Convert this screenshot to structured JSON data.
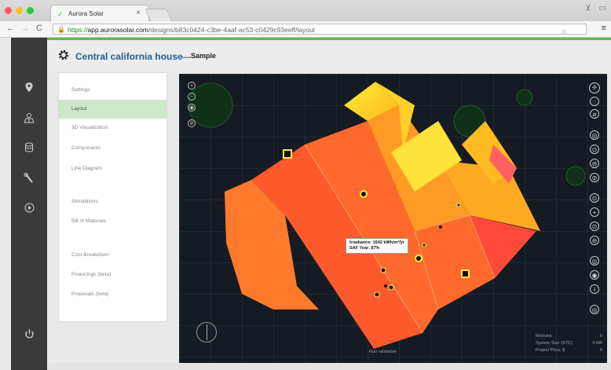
{
  "browser": {
    "tab_title": "Aurora Solar",
    "tab_close": "×",
    "url_scheme": "https://",
    "url_host": "app.aurorasolar.com",
    "url_path": "/designs/b83c0424-c3be-4aaf-ac53-c0429c93eeff/layout"
  },
  "header": {
    "title": "Central california house",
    "dash": "—",
    "subtitle": "Sample"
  },
  "nav": {
    "items": [
      {
        "label": "Settings",
        "active": false
      },
      {
        "label": "Layout",
        "active": true
      },
      {
        "label": "3D Visualization",
        "active": false
      },
      {
        "label": "Components",
        "active": false
      },
      {
        "label": "Line Diagram",
        "active": false
      },
      {
        "label": "Simulations",
        "active": false
      },
      {
        "label": "Bill of Materials",
        "active": false
      },
      {
        "label": "Cost Breakdown",
        "active": false
      },
      {
        "label": "Financings (beta)",
        "active": false
      },
      {
        "label": "Proposals (beta)",
        "active": false
      }
    ]
  },
  "canvas": {
    "tooltip_line1": "Irradiance: 1642 kWh/m²/yr",
    "tooltip_line2": "SAF Year: 87%",
    "run_validation": "Run validation",
    "stats": {
      "modules_label": "Modules",
      "modules_value": "0",
      "system_size_label": "System Size (STC)",
      "system_size_value": "0 kW",
      "project_price_label": "Project Price: $",
      "project_price_value": "0"
    }
  },
  "colors": {
    "accent_green": "#5fba46",
    "title_blue": "#1f5f96",
    "active_nav": "#cde8c9",
    "canvas_bg": "#151b22"
  }
}
